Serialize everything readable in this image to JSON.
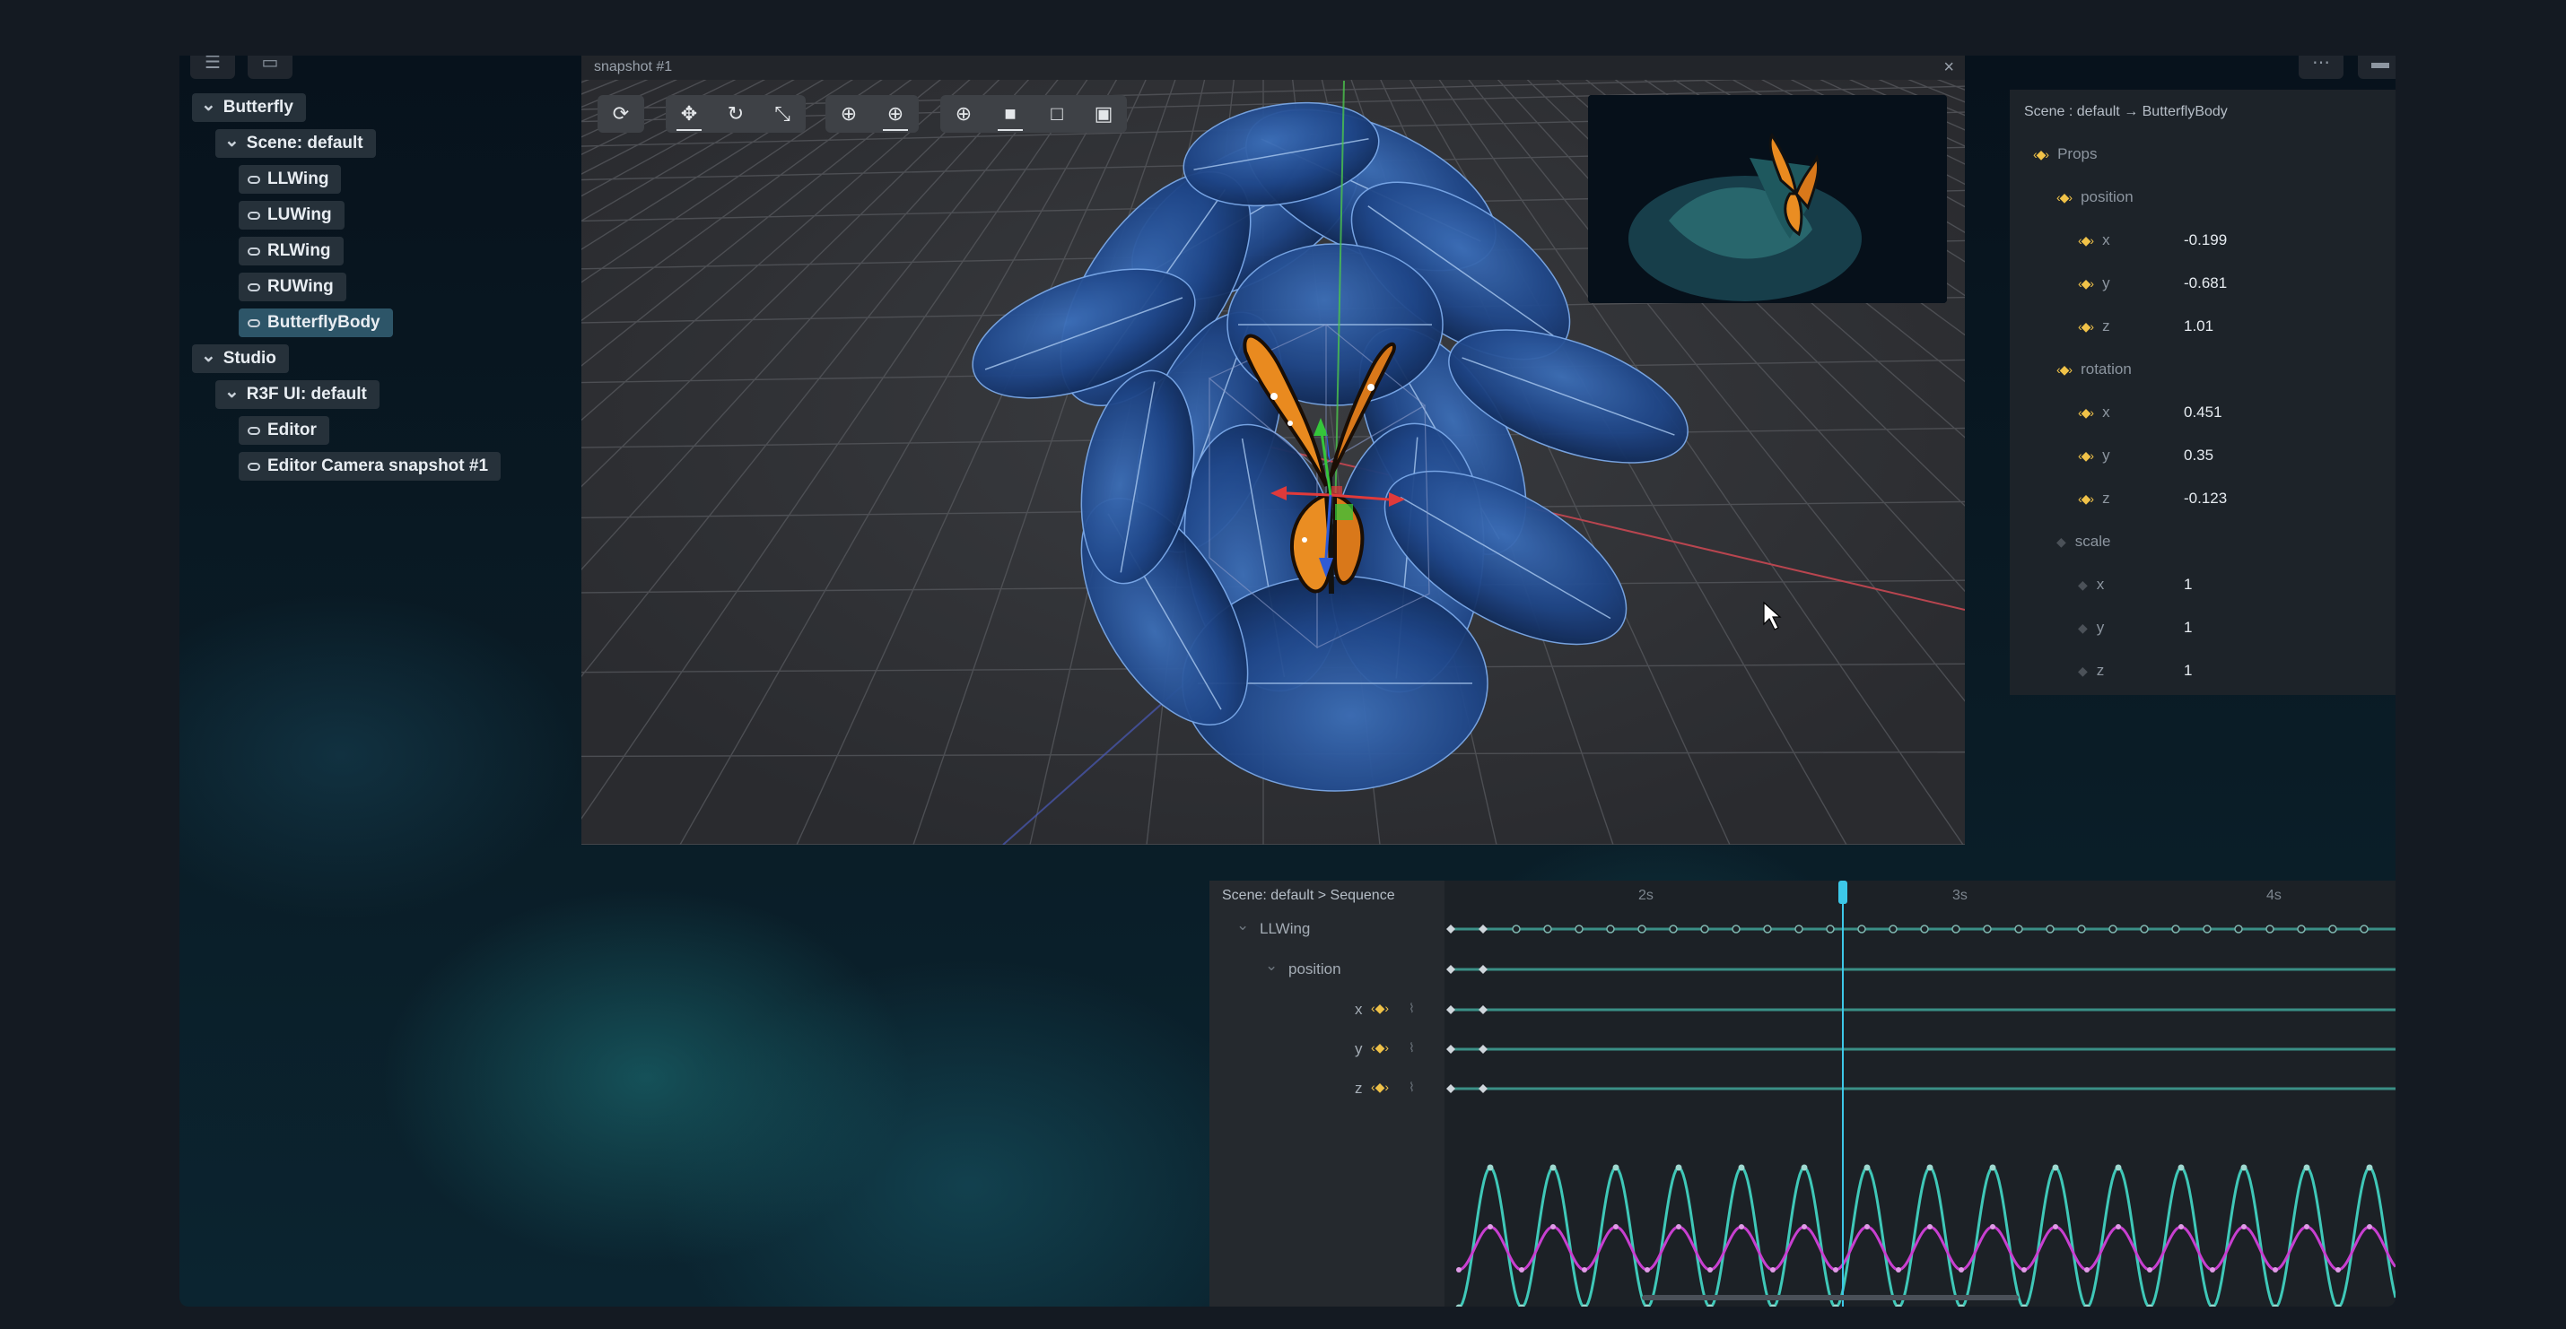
{
  "outline": {
    "items": [
      {
        "label": "Butterfly",
        "level": 0,
        "kind": "project"
      },
      {
        "label": "Scene: default",
        "level": 1,
        "kind": "sheet"
      },
      {
        "label": "LLWing",
        "level": 2,
        "kind": "object"
      },
      {
        "label": "LUWing",
        "level": 2,
        "kind": "object"
      },
      {
        "label": "RLWing",
        "level": 2,
        "kind": "object"
      },
      {
        "label": "RUWing",
        "level": 2,
        "kind": "object"
      },
      {
        "label": "ButterflyBody",
        "level": 2,
        "kind": "object",
        "selected": true
      },
      {
        "label": "Studio",
        "level": 0,
        "kind": "project"
      },
      {
        "label": "R3F UI: default",
        "level": 1,
        "kind": "sheet"
      },
      {
        "label": "Editor",
        "level": 2,
        "kind": "object"
      },
      {
        "label": "Editor Camera snapshot #1",
        "level": 2,
        "kind": "object"
      }
    ]
  },
  "viewport": {
    "title": "snapshot #1",
    "close_icon": "×",
    "toolbar": {
      "groups": [
        [
          {
            "icon": "refresh-icon",
            "glyph": "⟳",
            "active": false
          }
        ],
        [
          {
            "icon": "move-icon",
            "glyph": "✥",
            "active": true
          },
          {
            "icon": "rotate-icon",
            "glyph": "↻",
            "active": false
          },
          {
            "icon": "scale-icon",
            "glyph": "⤡",
            "active": false
          }
        ],
        [
          {
            "icon": "local-space-icon",
            "glyph": "⊕",
            "active": false
          },
          {
            "icon": "world-space-icon",
            "glyph": "⊕",
            "active": true
          }
        ],
        [
          {
            "icon": "view-globe-icon",
            "glyph": "⊕",
            "active": false
          },
          {
            "icon": "solid-cube-icon",
            "glyph": "■",
            "active": true
          },
          {
            "icon": "wire-cube-icon",
            "glyph": "□",
            "active": false
          },
          {
            "icon": "camera-cube-icon",
            "glyph": "▣",
            "active": false
          }
        ]
      ]
    }
  },
  "props": {
    "breadcrumb": "Scene : default → ButterflyBody",
    "root_label": "Props",
    "groups": [
      {
        "label": "position",
        "animated": true,
        "fields": [
          {
            "key": "x",
            "value": "-0.199"
          },
          {
            "key": "y",
            "value": "-0.681"
          },
          {
            "key": "z",
            "value": "1.01"
          }
        ]
      },
      {
        "label": "rotation",
        "animated": true,
        "fields": [
          {
            "key": "x",
            "value": "0.451"
          },
          {
            "key": "y",
            "value": "0.35"
          },
          {
            "key": "z",
            "value": "-0.123"
          }
        ]
      },
      {
        "label": "scale",
        "animated": false,
        "fields": [
          {
            "key": "x",
            "value": "1"
          },
          {
            "key": "y",
            "value": "1"
          },
          {
            "key": "z",
            "value": "1"
          }
        ]
      }
    ]
  },
  "sequence": {
    "breadcrumb": "Scene: default > Sequence",
    "ticks": [
      "2s",
      "3s",
      "4s"
    ],
    "tracks": [
      {
        "label": "LLWing"
      },
      {
        "label": "position"
      },
      {
        "label": "x"
      },
      {
        "label": "y"
      },
      {
        "label": "z"
      }
    ],
    "playhead_label": "3s",
    "colors": {
      "curve_teal": "#3fc8b8",
      "curve_magenta": "#c83fd0",
      "playhead": "#3dc8e8"
    }
  },
  "colors": {
    "accent_keyframe": "#f0c248",
    "selected_row": "#2d5568",
    "viewport_bg": "#2f3034"
  }
}
